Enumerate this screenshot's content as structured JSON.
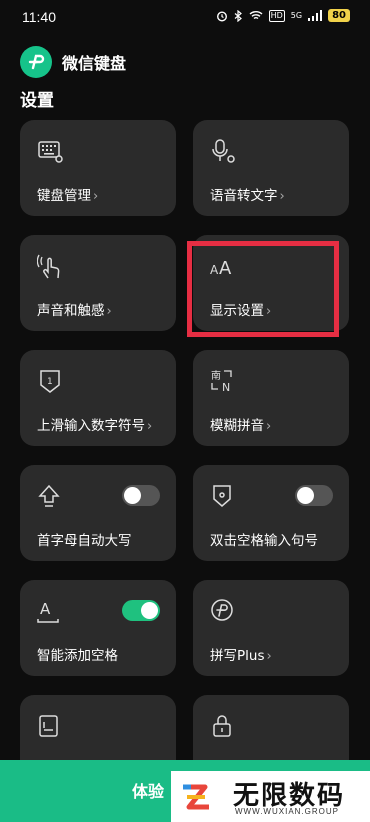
{
  "status_bar": {
    "time": "11:40",
    "hd_label": "HD",
    "network": "5G",
    "battery": "80"
  },
  "header": {
    "app_title": "微信键盘"
  },
  "section": {
    "title": "设置"
  },
  "cards": {
    "keyboard_manage": {
      "label": "键盘管理",
      "icon": "keyboard-settings-icon"
    },
    "voice_to_text": {
      "label": "语音转文字",
      "icon": "mic-settings-icon"
    },
    "sound_haptics": {
      "label": "声音和触感",
      "icon": "touch-vibrate-icon"
    },
    "display_settings": {
      "label": "显示设置",
      "icon": "font-size-icon"
    },
    "swipe_up_input": {
      "label": "上滑输入数字符号",
      "icon": "swipe-up-number-icon"
    },
    "fuzzy_pinyin": {
      "label": "模糊拼音",
      "icon": "fuzzy-pinyin-icon"
    },
    "auto_capitalize": {
      "label": "首字母自动大写",
      "icon": "shift-arrow-icon",
      "toggle": false
    },
    "double_space_period": {
      "label": "双击空格输入句号",
      "icon": "period-shield-icon",
      "toggle": false
    },
    "smart_space": {
      "label": "智能添加空格",
      "icon": "space-text-icon",
      "toggle": true
    },
    "pinyin_plus": {
      "label": "拼写Plus",
      "icon": "plus-logo-icon"
    },
    "card_11": {
      "label": "",
      "icon": "document-icon"
    },
    "card_12": {
      "label": "",
      "icon": "lock-icon"
    }
  },
  "banner": {
    "text": "体验"
  },
  "watermark": {
    "title": "无限数码",
    "subtitle": "WWW.WUXIAN.GROUP"
  },
  "colors": {
    "background": "#0d0d0d",
    "card": "#2b2b2b",
    "accent": "#1fc17f",
    "highlight": "#e62e43"
  }
}
